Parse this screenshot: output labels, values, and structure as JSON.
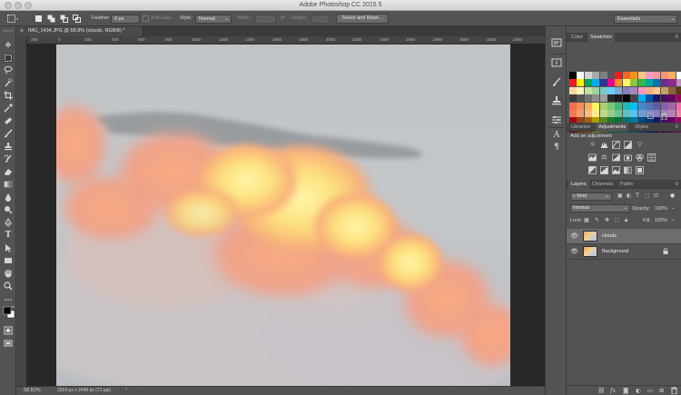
{
  "window": {
    "title": "Adobe Photoshop CC 2015.5"
  },
  "options_bar": {
    "feather_label": "Feather:",
    "feather_value": "0 px",
    "antialias_label": "Anti-alias",
    "style_label": "Style:",
    "style_value": "Normal",
    "width_label": "Width:",
    "height_label": "Height:",
    "select_mask_button": "Select and Mask...",
    "workspace": "Essentials"
  },
  "document": {
    "tab_close": "×",
    "tab_title": "IMG_1434.JPG @ 58.8% (clouds, RGB/8) *"
  },
  "ruler": {
    "h_ticks": [
      "200",
      "0",
      "200",
      "400",
      "600",
      "800",
      "1000",
      "1200",
      "1400",
      "1600",
      "1800",
      "2000",
      "2200",
      "2400",
      "2600",
      "2800",
      "3000",
      "3200",
      "3400"
    ]
  },
  "status": {
    "zoom": "58.82%",
    "dimensions": "3264 px x 2448 px (72 ppi)",
    "arrow": "›"
  },
  "color_panel": {
    "tabs": [
      "Color",
      "Swatches"
    ],
    "active_tab": "Swatches",
    "menu_icon": "≡",
    "swatches": [
      "#000000",
      "#ffffff",
      "#d4d4d4",
      "#a8a8a8",
      "#7f7f7f",
      "#545454",
      "#ed1c24",
      "#f26522",
      "#f7941d",
      "#fdc689",
      "#f49ac1",
      "#f6989d",
      "#f7977a",
      "#fbaf5d",
      "#ffffff",
      "#ed1c24",
      "#fff200",
      "#00a651",
      "#00aeef",
      "#2e3192",
      "#ec008c",
      "#f7941d",
      "#fff568",
      "#8dc63f",
      "#39b54a",
      "#00a99d",
      "#0072bc",
      "#662d91",
      "#92278f",
      "#bd8cbf",
      "#fbd6a5",
      "#fff9b3",
      "#c4df9b",
      "#a3d39c",
      "#7accc8",
      "#6dcff6",
      "#7da7d9",
      "#8781bd",
      "#a187be",
      "#f49ac2",
      "#f9ad81",
      "#fdc68a",
      "#c69c6d",
      "#8c6239",
      "#603913",
      "#3c3c3c",
      "#555555",
      "#707070",
      "#8e8e8e",
      "#9e9e9e",
      "#2a2a2a",
      "#1a1a1a",
      "#000000",
      "#464646",
      "#00aeef",
      "#0054a6",
      "#1b1464",
      "#440e62",
      "#630460",
      "#9e005d",
      "#f26c4f",
      "#f68e56",
      "#fbaf5d",
      "#fff467",
      "#acd372",
      "#7cc576",
      "#3bb878",
      "#1abbb4",
      "#00bff3",
      "#438ccb",
      "#5574b9",
      "#605ca8",
      "#855fa8",
      "#a763a8",
      "#f06ea9",
      "#ec7a5c",
      "#f49d68",
      "#f9bd7d",
      "#ffe98c",
      "#c0d98a",
      "#97cc8a",
      "#6cc398",
      "#5fc2c1",
      "#57c4ee",
      "#6b9dd2",
      "#7b8ac5",
      "#8880be",
      "#a07cba",
      "#b97fb6",
      "#ed83a7",
      "#9e0b0f",
      "#a0410d",
      "#a36209",
      "#aba000",
      "#598527",
      "#1a7b30",
      "#007236",
      "#00746b",
      "#0076a3",
      "#004a80",
      "#003471",
      "#1b1464",
      "#440e62",
      "#630460",
      "#9e005d",
      "#790000",
      "#7b2e00",
      "#7d4900",
      "#827b00",
      "#406618",
      "#005e20",
      "#005826",
      "#005952",
      "#005b7f",
      "#003663",
      "#002157",
      "#0d004c",
      "#32004b",
      "#4b0049",
      "#7b0046"
    ]
  },
  "adjustments_panel": {
    "tabs": [
      "Libraries",
      "Adjustments",
      "Styles"
    ],
    "active_tab": "Adjustments",
    "menu_icon": "≡",
    "title": "Add an adjustment",
    "row1_icons": [
      "brightness-contrast-icon",
      "levels-icon",
      "curves-icon",
      "exposure-icon",
      "vibrance-icon"
    ],
    "row2_icons": [
      "hue-saturation-icon",
      "color-balance-icon",
      "black-white-icon",
      "photo-filter-icon",
      "channel-mixer-icon",
      "color-lookup-icon"
    ],
    "row3_icons": [
      "invert-icon",
      "posterize-icon",
      "threshold-icon",
      "gradient-map-icon",
      "selective-color-icon"
    ]
  },
  "layers_panel": {
    "tabs": [
      "Layers",
      "Channels",
      "Paths"
    ],
    "active_tab": "Layers",
    "menu_icon": "≡",
    "kind_filter": "Kind",
    "blend_mode": "Normal",
    "opacity_label": "Opacity:",
    "opacity_value": "100%",
    "lock_label": "Lock:",
    "fill_label": "Fill:",
    "fill_value": "100%",
    "layers": [
      {
        "name": "clouds",
        "visible": true,
        "selected": true,
        "locked": false
      },
      {
        "name": "Background",
        "visible": true,
        "selected": false,
        "locked": true
      }
    ],
    "footer_icons": [
      "link-layers-icon",
      "fx-icon",
      "mask-icon",
      "adjustment-layer-icon",
      "group-icon",
      "new-layer-icon",
      "trash-icon"
    ]
  },
  "colors": {
    "ui_dark": "#535353",
    "panel_header": "#434343",
    "pasteboard": "#282828",
    "selection_highlight": "#6d6d6d"
  }
}
